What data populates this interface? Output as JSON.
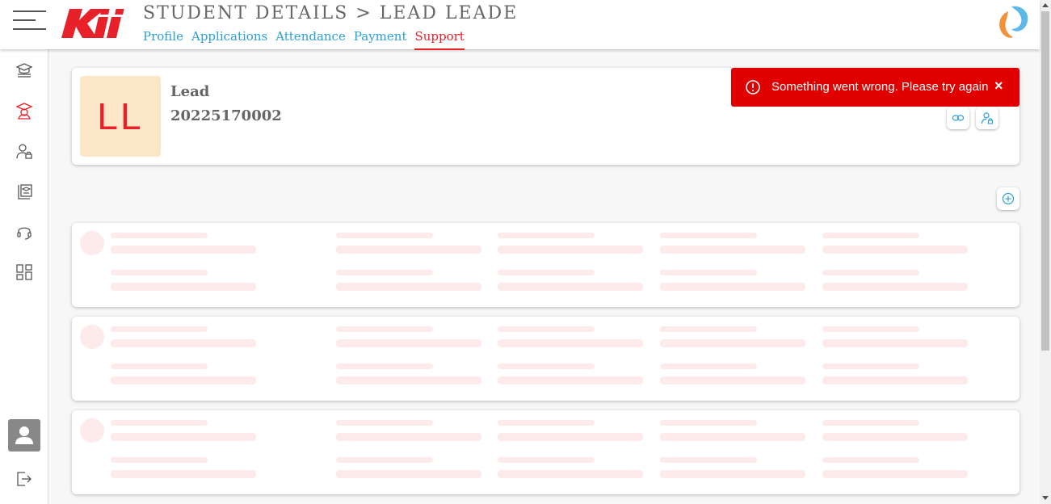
{
  "header": {
    "title": "STUDENT DETAILS > LEAD LEADE",
    "tabs": [
      {
        "label": "Profile",
        "active": false
      },
      {
        "label": "Applications",
        "active": false
      },
      {
        "label": "Attendance",
        "active": false
      },
      {
        "label": "Payment",
        "active": false
      },
      {
        "label": "Support",
        "active": true
      }
    ]
  },
  "sidebar": {
    "items": [
      {
        "icon": "courses-icon",
        "active": false
      },
      {
        "icon": "student-icon",
        "active": true
      },
      {
        "icon": "user-lock-icon",
        "active": false
      },
      {
        "icon": "certificate-icon",
        "active": false
      },
      {
        "icon": "headset-icon",
        "active": false
      },
      {
        "icon": "dashboard-grid-icon",
        "active": false
      }
    ],
    "bottom": [
      "user-avatar-icon",
      "logout-icon"
    ]
  },
  "profile": {
    "initials": "LL",
    "name": "Lead",
    "id": "20225170002"
  },
  "toast": {
    "message": "Something went wrong. Please try again",
    "close": "×"
  },
  "colors": {
    "accent_red": "#e8202a",
    "link_blue": "#2a9fd8",
    "toast_bg": "#e00000",
    "avatar_bg": "#fbe6c7",
    "skeleton": "#fdeaea"
  },
  "skeleton_cards": 3
}
